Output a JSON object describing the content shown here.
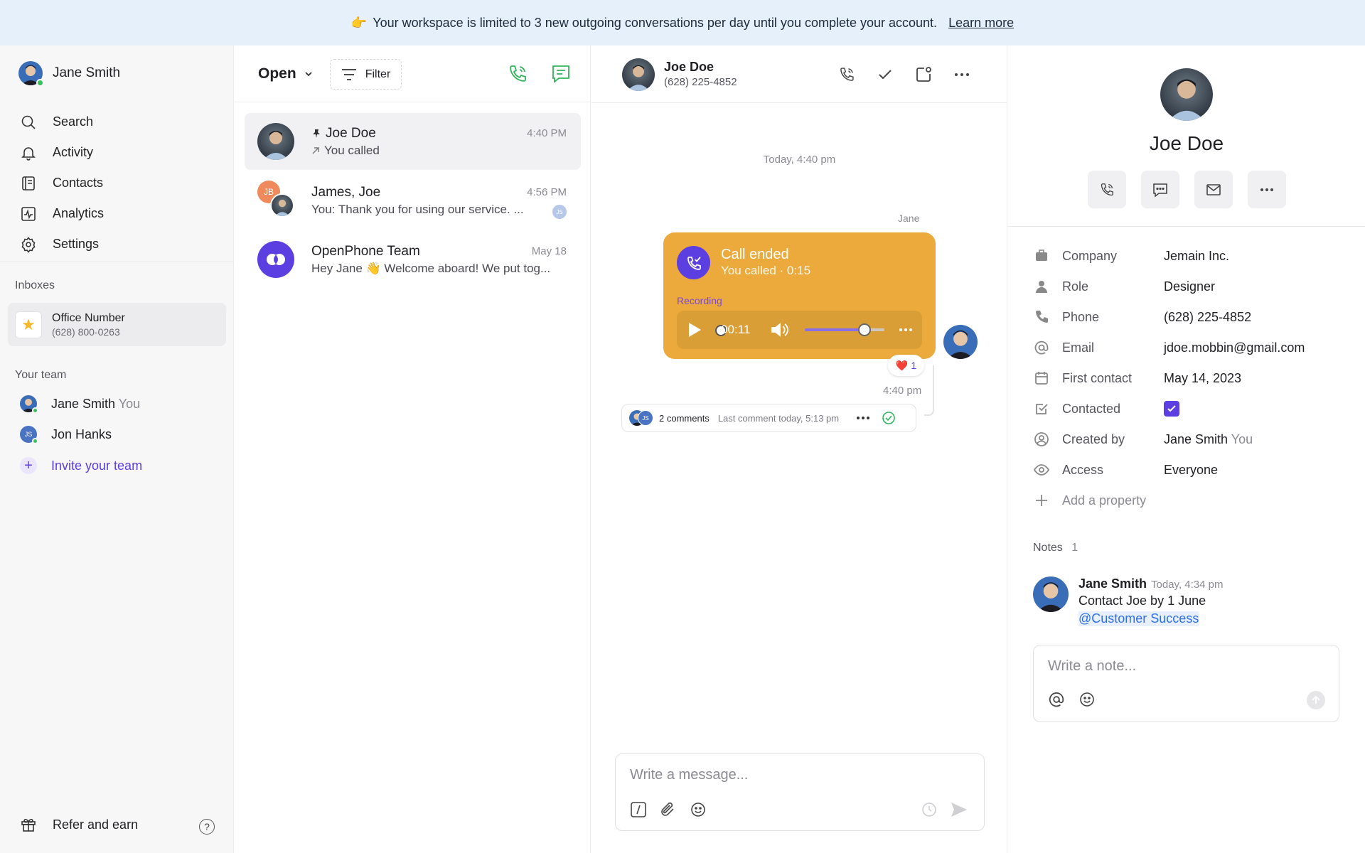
{
  "banner": {
    "emoji": "👉",
    "text": "Your workspace is limited to 3 new outgoing conversations per day until you complete your account.",
    "link": "Learn more"
  },
  "sidebar": {
    "user_name": "Jane Smith",
    "nav": [
      {
        "label": "Search",
        "icon": "search-icon"
      },
      {
        "label": "Activity",
        "icon": "bell-icon"
      },
      {
        "label": "Contacts",
        "icon": "contacts-icon"
      },
      {
        "label": "Analytics",
        "icon": "analytics-icon"
      },
      {
        "label": "Settings",
        "icon": "gear-icon"
      }
    ],
    "inboxes_label": "Inboxes",
    "inbox": {
      "name": "Office Number",
      "number": "(628) 800-0263",
      "icon": "star-icon"
    },
    "team_label": "Your team",
    "team": [
      {
        "name": "Jane Smith",
        "suffix": "You"
      },
      {
        "name": "Jon Hanks",
        "suffix": "",
        "initials": "JS"
      }
    ],
    "invite_label": "Invite your team",
    "refer_label": "Refer and earn",
    "help_glyph": "?"
  },
  "conversations": {
    "status": "Open",
    "filter_label": "Filter",
    "items": [
      {
        "name": "Joe Doe",
        "time": "4:40 PM",
        "preview": "You called",
        "pinned": true
      },
      {
        "name": "James, Joe",
        "time": "4:56 PM",
        "preview": "You: Thank you for using our service. ...",
        "initials": "JB",
        "badge": "JS"
      },
      {
        "name": "OpenPhone Team",
        "time": "May 18",
        "preview": "Hey Jane 👋 Welcome aboard! We put tog..."
      }
    ]
  },
  "chat": {
    "contact_name": "Joe Doe",
    "contact_phone": "(628) 225-4852",
    "date_divider": "Today, 4:40 pm",
    "sender": "Jane",
    "call": {
      "title": "Call ended",
      "subtitle": "You called · 0:15",
      "recording_label": "Recording",
      "elapsed": "00:11",
      "volume": 0.75
    },
    "reaction": {
      "emoji": "❤️",
      "count": "1"
    },
    "message_time": "4:40 pm",
    "comments": {
      "count_label": "2 comments",
      "last_label": "Last comment today, 5:13 pm",
      "avatar_initials": "JS"
    },
    "composer_placeholder": "Write a message..."
  },
  "contact": {
    "name": "Joe Doe",
    "properties": [
      {
        "key": "Company",
        "value": "Jemain Inc.",
        "icon": "building-icon"
      },
      {
        "key": "Role",
        "value": "Designer",
        "icon": "person-icon"
      },
      {
        "key": "Phone",
        "value": "(628) 225-4852",
        "icon": "phone-icon"
      },
      {
        "key": "Email",
        "value": "jdoe.mobbin@gmail.com",
        "icon": "at-icon"
      },
      {
        "key": "First contact",
        "value": "May 14, 2023",
        "icon": "calendar-icon"
      },
      {
        "key": "Contacted",
        "value": "",
        "icon": "checkbox-icon",
        "checked": true
      },
      {
        "key": "Created by",
        "value": "Jane Smith",
        "value_suffix": "You",
        "icon": "user-circle-icon"
      },
      {
        "key": "Access",
        "value": "Everyone",
        "icon": "eye-icon"
      }
    ],
    "add_property": "Add a property",
    "notes_label": "Notes",
    "notes_count": "1",
    "note": {
      "author": "Jane Smith",
      "time": "Today, 4:34 pm",
      "text": "Contact Joe by 1 June",
      "mention": "@Customer Success"
    },
    "note_placeholder": "Write a note..."
  },
  "colors": {
    "accent": "#5b3fe0",
    "call_card": "#ebaa3b",
    "banner": "#e6f0fa",
    "online": "#3ac05a",
    "green_icon": "#2fb55a"
  }
}
